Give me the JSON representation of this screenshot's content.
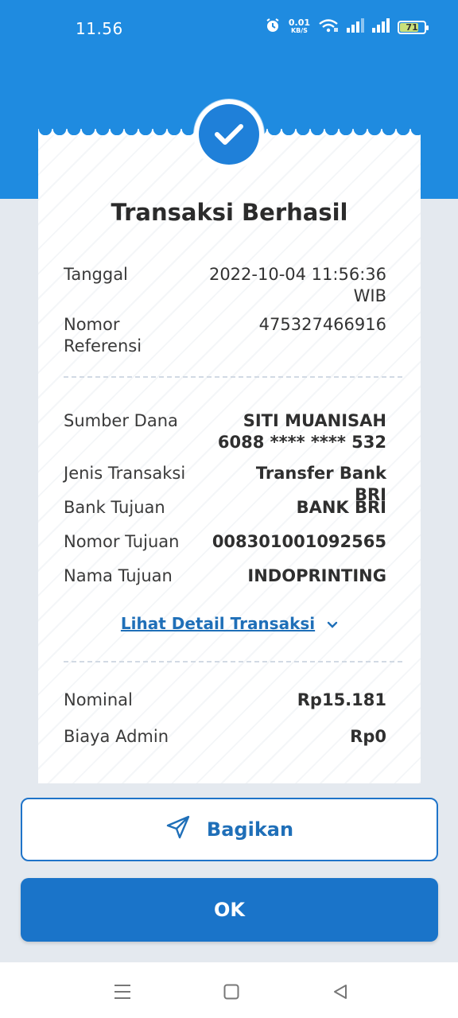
{
  "status_bar": {
    "time": "11.56",
    "net_speed_value": "0.01",
    "net_speed_unit": "KB/S",
    "battery": "71",
    "battery_level": 0.71,
    "icons": [
      "alarm-icon",
      "wifi-icon",
      "signal-icon",
      "signal-icon",
      "battery-icon"
    ]
  },
  "receipt": {
    "title": "Transaksi Berhasil",
    "status_icon": "check-icon",
    "section1": {
      "tanggal_label": "Tanggal",
      "tanggal_value_line1": "2022-10-04 11:56:36",
      "tanggal_value_line2": "WIB",
      "referensi_label_line1": "Nomor",
      "referensi_label_line2": "Referensi",
      "referensi_value": "475327466916"
    },
    "section2": {
      "sumber_label": "Sumber Dana",
      "sumber_name": "SITI MUANISAH",
      "sumber_account": "6088 **** **** 532",
      "jenis_label": "Jenis Transaksi",
      "jenis_value": "Transfer Bank BRI",
      "bank_label": "Bank Tujuan",
      "bank_value": "BANK BRI",
      "nomor_label": "Nomor Tujuan",
      "nomor_value": "008301001092565",
      "nama_label": "Nama Tujuan",
      "nama_value": "INDOPRINTING"
    },
    "detail_link": "Lihat Detail Transaksi",
    "section3": {
      "nominal_label": "Nominal",
      "nominal_value": "Rp15.181",
      "admin_label": "Biaya Admin",
      "admin_value": "Rp0"
    }
  },
  "buttons": {
    "share_label": "Bagikan",
    "ok_label": "OK"
  },
  "nav_bar": {
    "items": [
      "menu-icon",
      "home-icon",
      "back-icon"
    ]
  },
  "colors": {
    "header_blue": "#1f8be0",
    "button_blue": "#1a74c9",
    "link_blue": "#1f6fb8",
    "page_bg": "#e4e9ef"
  }
}
